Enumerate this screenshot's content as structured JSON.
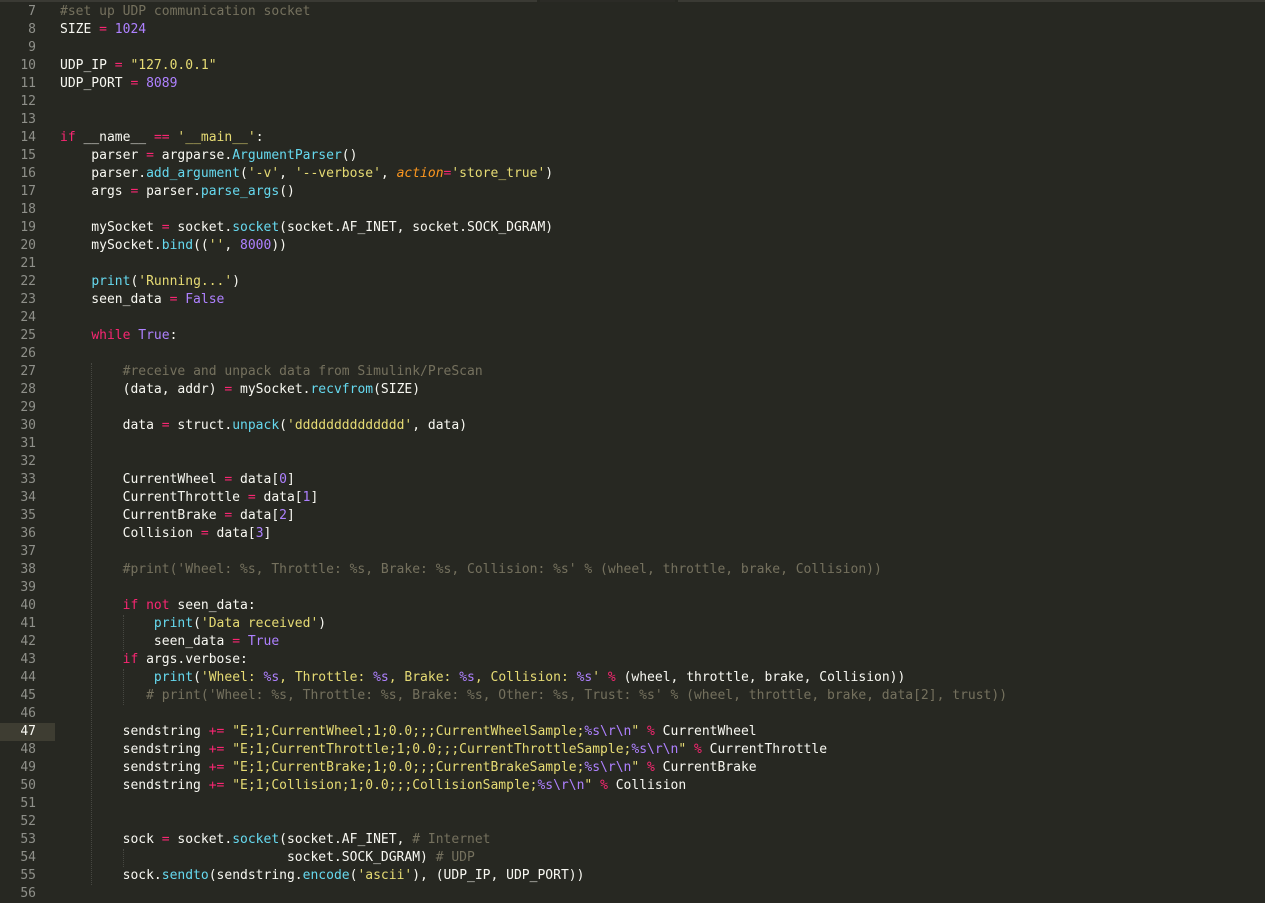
{
  "editor": {
    "theme": {
      "background": "#272822",
      "comment": "#75715e",
      "number": "#ae81ff",
      "string": "#e6db74",
      "keyword": "#f92672",
      "function": "#66d9ef",
      "parameter": "#fd971f",
      "active_line": "#3e3d32"
    },
    "active_line": "47",
    "lines": [
      {
        "n": "7",
        "t": [
          [
            "c",
            "#set up UDP communication socket"
          ]
        ]
      },
      {
        "n": "8",
        "t": [
          [
            "t",
            "SIZE "
          ],
          [
            "o",
            "="
          ],
          [
            "t",
            " "
          ],
          [
            "n",
            "1024"
          ]
        ]
      },
      {
        "n": "9",
        "t": []
      },
      {
        "n": "10",
        "t": [
          [
            "t",
            "UDP_IP "
          ],
          [
            "o",
            "="
          ],
          [
            "t",
            " "
          ],
          [
            "s",
            "\"127.0.0.1\""
          ]
        ]
      },
      {
        "n": "11",
        "t": [
          [
            "t",
            "UDP_PORT "
          ],
          [
            "o",
            "="
          ],
          [
            "t",
            " "
          ],
          [
            "n",
            "8089"
          ]
        ]
      },
      {
        "n": "12",
        "t": []
      },
      {
        "n": "13",
        "t": []
      },
      {
        "n": "14",
        "t": [
          [
            "k",
            "if"
          ],
          [
            "t",
            " __name__ "
          ],
          [
            "o",
            "=="
          ],
          [
            "t",
            " "
          ],
          [
            "s",
            "'__main__'"
          ],
          [
            "t",
            ":"
          ]
        ]
      },
      {
        "n": "15",
        "t": [
          [
            "t",
            "    parser "
          ],
          [
            "o",
            "="
          ],
          [
            "t",
            " argparse."
          ],
          [
            "f",
            "ArgumentParser"
          ],
          [
            "t",
            "()"
          ]
        ]
      },
      {
        "n": "16",
        "t": [
          [
            "t",
            "    parser."
          ],
          [
            "f",
            "add_argument"
          ],
          [
            "t",
            "("
          ],
          [
            "s",
            "'-v'"
          ],
          [
            "t",
            ", "
          ],
          [
            "s",
            "'--verbose'"
          ],
          [
            "t",
            ", "
          ],
          [
            "p",
            "action"
          ],
          [
            "o",
            "="
          ],
          [
            "s",
            "'store_true'"
          ],
          [
            "t",
            ")"
          ]
        ]
      },
      {
        "n": "17",
        "t": [
          [
            "t",
            "    args "
          ],
          [
            "o",
            "="
          ],
          [
            "t",
            " parser."
          ],
          [
            "f",
            "parse_args"
          ],
          [
            "t",
            "()"
          ]
        ]
      },
      {
        "n": "18",
        "t": []
      },
      {
        "n": "19",
        "t": [
          [
            "t",
            "    mySocket "
          ],
          [
            "o",
            "="
          ],
          [
            "t",
            " socket."
          ],
          [
            "f",
            "socket"
          ],
          [
            "t",
            "(socket.AF_INET, socket.SOCK_DGRAM)"
          ]
        ]
      },
      {
        "n": "20",
        "t": [
          [
            "t",
            "    mySocket."
          ],
          [
            "f",
            "bind"
          ],
          [
            "t",
            "(("
          ],
          [
            "s",
            "''"
          ],
          [
            "t",
            ", "
          ],
          [
            "n",
            "8000"
          ],
          [
            "t",
            "))"
          ]
        ]
      },
      {
        "n": "21",
        "t": []
      },
      {
        "n": "22",
        "t": [
          [
            "t",
            "    "
          ],
          [
            "f",
            "print"
          ],
          [
            "t",
            "("
          ],
          [
            "s",
            "'Running...'"
          ],
          [
            "t",
            ")"
          ]
        ]
      },
      {
        "n": "23",
        "t": [
          [
            "t",
            "    seen_data "
          ],
          [
            "o",
            "="
          ],
          [
            "t",
            " "
          ],
          [
            "n",
            "False"
          ]
        ]
      },
      {
        "n": "24",
        "t": []
      },
      {
        "n": "25",
        "t": [
          [
            "t",
            "    "
          ],
          [
            "k",
            "while"
          ],
          [
            "t",
            " "
          ],
          [
            "n",
            "True"
          ],
          [
            "t",
            ":"
          ]
        ]
      },
      {
        "n": "26",
        "t": []
      },
      {
        "n": "27",
        "t": [
          [
            "t",
            "        "
          ],
          [
            "c",
            "#receive and unpack data from Simulink/PreScan"
          ]
        ]
      },
      {
        "n": "28",
        "t": [
          [
            "t",
            "        (data, addr) "
          ],
          [
            "o",
            "="
          ],
          [
            "t",
            " mySocket."
          ],
          [
            "f",
            "recvfrom"
          ],
          [
            "t",
            "(SIZE)"
          ]
        ]
      },
      {
        "n": "29",
        "t": []
      },
      {
        "n": "30",
        "t": [
          [
            "t",
            "        data "
          ],
          [
            "o",
            "="
          ],
          [
            "t",
            " struct."
          ],
          [
            "f",
            "unpack"
          ],
          [
            "t",
            "("
          ],
          [
            "s",
            "'dddddddddddddd'"
          ],
          [
            "t",
            ", data)"
          ]
        ]
      },
      {
        "n": "31",
        "t": []
      },
      {
        "n": "32",
        "t": []
      },
      {
        "n": "33",
        "t": [
          [
            "t",
            "        CurrentWheel "
          ],
          [
            "o",
            "="
          ],
          [
            "t",
            " data["
          ],
          [
            "n",
            "0"
          ],
          [
            "t",
            "]"
          ]
        ]
      },
      {
        "n": "34",
        "t": [
          [
            "t",
            "        CurrentThrottle "
          ],
          [
            "o",
            "="
          ],
          [
            "t",
            " data["
          ],
          [
            "n",
            "1"
          ],
          [
            "t",
            "]"
          ]
        ]
      },
      {
        "n": "35",
        "t": [
          [
            "t",
            "        CurrentBrake "
          ],
          [
            "o",
            "="
          ],
          [
            "t",
            " data["
          ],
          [
            "n",
            "2"
          ],
          [
            "t",
            "]"
          ]
        ]
      },
      {
        "n": "36",
        "t": [
          [
            "t",
            "        Collision "
          ],
          [
            "o",
            "="
          ],
          [
            "t",
            " data["
          ],
          [
            "n",
            "3"
          ],
          [
            "t",
            "]"
          ]
        ]
      },
      {
        "n": "37",
        "t": []
      },
      {
        "n": "38",
        "t": [
          [
            "t",
            "        "
          ],
          [
            "c",
            "#print('Wheel: %s, Throttle: %s, Brake: %s, Collision: %s' % (wheel, throttle, brake, Collision))"
          ]
        ]
      },
      {
        "n": "39",
        "t": []
      },
      {
        "n": "40",
        "t": [
          [
            "t",
            "        "
          ],
          [
            "k",
            "if"
          ],
          [
            "t",
            " "
          ],
          [
            "k",
            "not"
          ],
          [
            "t",
            " seen_data:"
          ]
        ]
      },
      {
        "n": "41",
        "t": [
          [
            "t",
            "            "
          ],
          [
            "f",
            "print"
          ],
          [
            "t",
            "("
          ],
          [
            "s",
            "'Data received'"
          ],
          [
            "t",
            ")"
          ]
        ]
      },
      {
        "n": "42",
        "t": [
          [
            "t",
            "            seen_data "
          ],
          [
            "o",
            "="
          ],
          [
            "t",
            " "
          ],
          [
            "n",
            "True"
          ]
        ]
      },
      {
        "n": "43",
        "t": [
          [
            "t",
            "        "
          ],
          [
            "k",
            "if"
          ],
          [
            "t",
            " args.verbose:"
          ]
        ]
      },
      {
        "n": "44",
        "t": [
          [
            "t",
            "            "
          ],
          [
            "f",
            "print"
          ],
          [
            "t",
            "("
          ],
          [
            "s",
            "'Wheel: "
          ],
          [
            "e",
            "%s"
          ],
          [
            "s",
            ", Throttle: "
          ],
          [
            "e",
            "%s"
          ],
          [
            "s",
            ", Brake: "
          ],
          [
            "e",
            "%s"
          ],
          [
            "s",
            ", Collision: "
          ],
          [
            "e",
            "%s"
          ],
          [
            "s",
            "'"
          ],
          [
            "t",
            " "
          ],
          [
            "o",
            "%"
          ],
          [
            "t",
            " (wheel, throttle, brake, Collision))"
          ]
        ]
      },
      {
        "n": "45",
        "t": [
          [
            "t",
            "           "
          ],
          [
            "c",
            "# print('Wheel: %s, Throttle: %s, Brake: %s, Other: %s, Trust: %s' % (wheel, throttle, brake, data[2], trust))"
          ]
        ]
      },
      {
        "n": "46",
        "t": []
      },
      {
        "n": "47",
        "t": [
          [
            "t",
            "        sendstring "
          ],
          [
            "o",
            "+="
          ],
          [
            "t",
            " "
          ],
          [
            "s",
            "\"E;1;CurrentWheel;1;0.0;;;CurrentWheelSample;"
          ],
          [
            "e",
            "%s\\r\\n"
          ],
          [
            "s",
            "\""
          ],
          [
            "t",
            " "
          ],
          [
            "o",
            "%"
          ],
          [
            "t",
            " CurrentWheel"
          ]
        ]
      },
      {
        "n": "48",
        "t": [
          [
            "t",
            "        sendstring "
          ],
          [
            "o",
            "+="
          ],
          [
            "t",
            " "
          ],
          [
            "s",
            "\"E;1;CurrentThrottle;1;0.0;;;CurrentThrottleSample;"
          ],
          [
            "e",
            "%s\\r\\n"
          ],
          [
            "s",
            "\""
          ],
          [
            "t",
            " "
          ],
          [
            "o",
            "%"
          ],
          [
            "t",
            " CurrentThrottle"
          ]
        ]
      },
      {
        "n": "49",
        "t": [
          [
            "t",
            "        sendstring "
          ],
          [
            "o",
            "+="
          ],
          [
            "t",
            " "
          ],
          [
            "s",
            "\"E;1;CurrentBrake;1;0.0;;;CurrentBrakeSample;"
          ],
          [
            "e",
            "%s\\r\\n"
          ],
          [
            "s",
            "\""
          ],
          [
            "t",
            " "
          ],
          [
            "o",
            "%"
          ],
          [
            "t",
            " CurrentBrake"
          ]
        ]
      },
      {
        "n": "50",
        "t": [
          [
            "t",
            "        sendstring "
          ],
          [
            "o",
            "+="
          ],
          [
            "t",
            " "
          ],
          [
            "s",
            "\"E;1;Collision;1;0.0;;;CollisionSample;"
          ],
          [
            "e",
            "%s\\r\\n"
          ],
          [
            "s",
            "\""
          ],
          [
            "t",
            " "
          ],
          [
            "o",
            "%"
          ],
          [
            "t",
            " Collision"
          ]
        ]
      },
      {
        "n": "51",
        "t": []
      },
      {
        "n": "52",
        "t": []
      },
      {
        "n": "53",
        "t": [
          [
            "t",
            "        sock "
          ],
          [
            "o",
            "="
          ],
          [
            "t",
            " socket."
          ],
          [
            "f",
            "socket"
          ],
          [
            "t",
            "(socket.AF_INET, "
          ],
          [
            "c",
            "# Internet"
          ]
        ]
      },
      {
        "n": "54",
        "t": [
          [
            "t",
            "                             socket.SOCK_DGRAM) "
          ],
          [
            "c",
            "# UDP"
          ]
        ]
      },
      {
        "n": "55",
        "t": [
          [
            "t",
            "        sock."
          ],
          [
            "f",
            "sendto"
          ],
          [
            "t",
            "(sendstring."
          ],
          [
            "f",
            "encode"
          ],
          [
            "t",
            "("
          ],
          [
            "s",
            "'ascii'"
          ],
          [
            "t",
            "), (UDP_IP, UDP_PORT))"
          ]
        ]
      },
      {
        "n": "56",
        "t": []
      }
    ]
  }
}
